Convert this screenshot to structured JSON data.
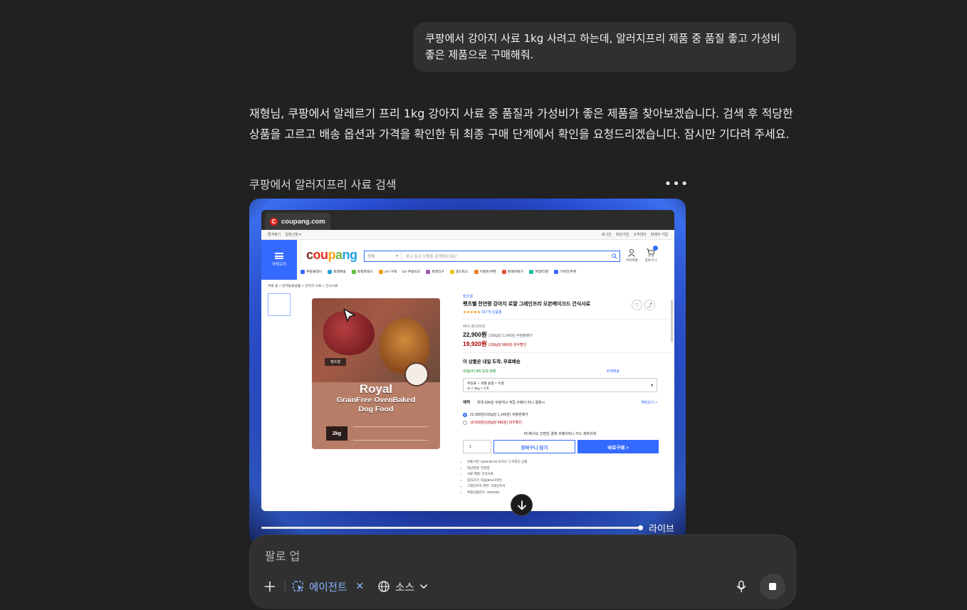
{
  "user_message": "쿠팡에서 강아지 사료 1kg 사려고 하는데, 알러지프리 제품 중 품질 좋고 가성비 좋은 제품으로 구매해줘.",
  "assistant_message": "재형님, 쿠팡에서 알레르기 프리 1kg 강아지 사료 중 품질과 가성비가 좋은 제품을 찾아보겠습니다. 검색 후 적당한 상품을 고르고 배송 옵션과 가격을 확인한 뒤 최종 구매 단계에서 확인을 요청드리겠습니다. 잠시만 기다려 주세요.",
  "task": {
    "title": "쿠팡에서 알러지프리 사료 검색",
    "more_label": "•••"
  },
  "browser": {
    "tab_label": "coupang.com",
    "favicon_letter": "C"
  },
  "site": {
    "topbar_left": [
      "즐겨찾기",
      "입점신청 ▾"
    ],
    "topbar_right": [
      "로그인",
      "회원가입",
      "고객센터",
      "판매자 가입"
    ],
    "category_label": "카테고리",
    "logo_parts": [
      "c",
      "ou",
      "p",
      "a",
      "ng"
    ],
    "search_category": "전체",
    "search_placeholder": "찾고 싶은 상품을 검색해보세요!",
    "header_icons": [
      "마이쿠팡",
      "장바구니"
    ],
    "quicknav": [
      "쿠팡플레이",
      "로켓배송",
      "로켓프레시",
      "2시 구매",
      "biz 쿠팡비즈",
      "로켓직구",
      "골드박스",
      "이벤트/쿠폰",
      "판매자특가",
      "여행/티켓",
      "기획전/쿠폰"
    ],
    "breadcrumb": "쿠팡 홈 > 반려동물용품 > 강아지 사료 > 건식사료",
    "product_image": {
      "brand_badge": "펫츠웰",
      "title_line1": "Royal",
      "title_line2": "GrainFree OvenBaked",
      "title_line3": "Dog Food",
      "weight": "2kg"
    },
    "product": {
      "brand": "펫츠웰",
      "title": "펫츠웰 전연령 강아지 로얄 그레인프리 오븐베이크드 건식사료",
      "rating": "★★★★★",
      "review_count": "597개 상품평",
      "discount_line": "46% 38,000원",
      "price": "22,900원",
      "price_unit": "(100g당 1,145원) 쿠팡판매가",
      "coupon_price": "19,920원",
      "coupon_unit": "(100g당 996원) 와우할인",
      "shipping": "이 상품은 내일 도착, 무료배송",
      "eta": "내일(수) 8/6 도착 보장",
      "fast": "로켓배송",
      "option_line1": "주원료 × 개월 용량 × 수량",
      "option_line2": "소 × 2kg × 1개",
      "benefit_label": "혜택",
      "benefit_text": "최대 936원 쿠팡캐시 적립  쿠페이 머니 결제시",
      "benefit_more": "혜택보기 >",
      "option1": "22,900원(100g당 1,145원)  쿠팡판매가",
      "option2": "19,920원(100g당 996원)  와우할인",
      "pc_pay": "PC에서도 간편한 결제  쿠페이머니  카드  계좌이체",
      "qty": "1",
      "cart_btn": "장바구니 담기",
      "buy_btn": "바로구매 >",
      "details": [
        "유통기한: 2026-02-03 이거나 그 이후인 상품",
        "대상연령: 전연령",
        "사료 제형: 건식사료",
        "입자크기: 작음(8mm미만)",
        "그레인프리 여부: 그레인프리",
        "쿠팡상품번호: 7922228"
      ]
    }
  },
  "live_label": "라이브",
  "composer": {
    "input_text": "팔로 업",
    "agent_label": "에이전트",
    "source_label": "소스"
  },
  "colors": {
    "bg": "#212121",
    "bubble": "#303030",
    "accent": "#346aff",
    "agent_blue": "#8ab4ff"
  },
  "icons": [
    "more-icon",
    "cursor-icon",
    "arrow-down-icon",
    "plus-icon",
    "agent-icon",
    "close-icon",
    "globe-icon",
    "chevron-down-icon",
    "mic-icon",
    "stop-icon"
  ]
}
